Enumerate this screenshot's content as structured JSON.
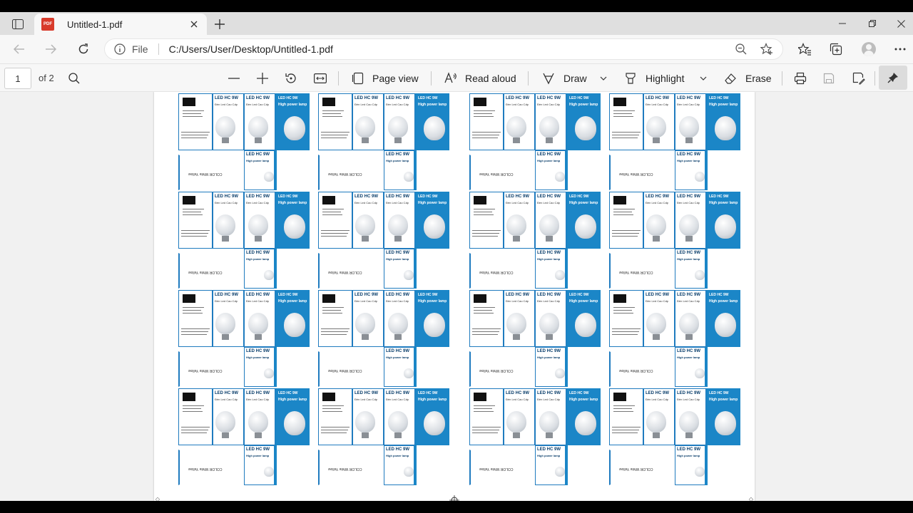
{
  "browser": {
    "tab_title": "Untitled-1.pdf",
    "url_scheme": "File",
    "url": "C:/Users/User/Desktop/Untitled-1.pdf"
  },
  "pdf_toolbar": {
    "page_current": "1",
    "page_total": "of 2",
    "page_view_label": "Page view",
    "read_aloud_label": "Read aloud",
    "draw_label": "Draw",
    "highlight_label": "Highlight",
    "erase_label": "Erase"
  },
  "document": {
    "tile_texts": {
      "led_title": "LED HC 9W",
      "line1": "Đèn Led Cao Cấp",
      "line2": "High power lamp",
      "side_label": "COLOR White Yellow"
    }
  },
  "colors": {
    "accent_blue": "#1b86c7",
    "pdf_icon": "#d83b2b"
  }
}
